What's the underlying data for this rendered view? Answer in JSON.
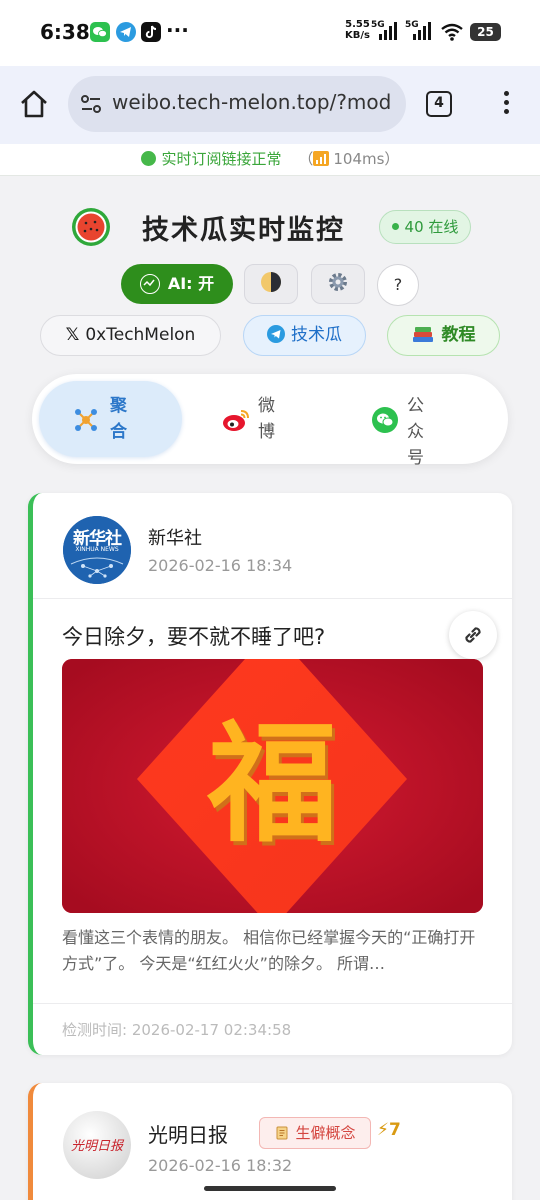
{
  "status_bar": {
    "time": "6:38",
    "more": "···",
    "net_speed_value": "5.55",
    "net_speed_unit": "KB/s",
    "sim1": "5G",
    "sim2": "5G",
    "battery": "25"
  },
  "browser": {
    "url": "weibo.tech-melon.top/?mod",
    "tab_count": "4"
  },
  "banner": {
    "status_text": "实时订阅链接正常",
    "latency_prefix": "（",
    "latency": "104ms",
    "latency_suffix": "）"
  },
  "header": {
    "title": "技术瓜实时监控",
    "online_count": "40",
    "online_label": "在线",
    "ai_label": "AI: 开",
    "help_label": "?"
  },
  "links": {
    "x_label": "0xTechMelon",
    "telegram_label": "技术瓜",
    "tutorial_label": "教程"
  },
  "source_tabs": [
    {
      "label": "聚合",
      "icon": "aggregate-icon",
      "active": true
    },
    {
      "label": "微博",
      "icon": "weibo-icon",
      "active": false
    },
    {
      "label": "公众号",
      "icon": "wechat-icon",
      "active": false
    }
  ],
  "posts": [
    {
      "source": "新华社",
      "time": "2026-02-16 18:34",
      "title": "今日除夕，要不就不睡了吧?",
      "image_text": "福",
      "excerpt": "看懂这三个表情的朋友。 相信你已经掌握今天的“正确打开方式”了。 今天是“红红火火”的除夕。 所谓…",
      "detect_label": "检测时间:",
      "detect_time": "2026-02-17 02:34:58",
      "accent": "#3bbf57"
    },
    {
      "source": "光明日报",
      "time": "2026-02-16 18:32",
      "tag": "生僻概念",
      "score": "7",
      "accent": "#f08a3c"
    }
  ],
  "avatar_text": {
    "xinhua_cn": "新华社",
    "xinhua_en": "XINHUA NEWS",
    "guangming": "光明日报"
  },
  "colors": {
    "ai_button": "#2e8e1c",
    "active_tab_bg": "#dcebfa",
    "online_green": "#38b24a",
    "rare_tag": "#d4453f"
  }
}
